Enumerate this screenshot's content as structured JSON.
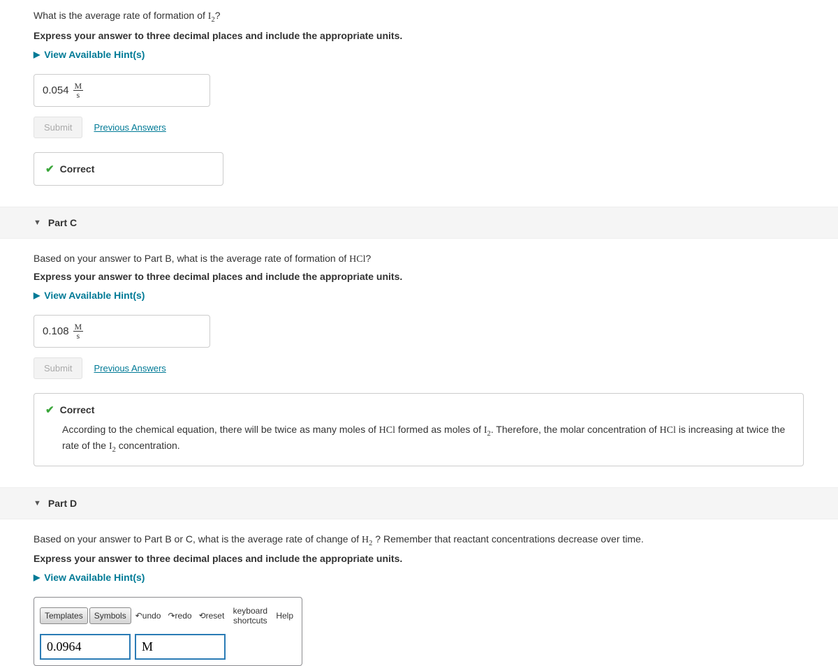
{
  "partB": {
    "question": "What is the average rate of formation of ",
    "question_formula": "I",
    "question_sub": "2",
    "question_tail": "?",
    "instruction": "Express your answer to three decimal places and include the appropriate units.",
    "hints_label": "View Available Hint(s)",
    "answer_value": "0.054",
    "answer_unit_num": "M",
    "answer_unit_den": "s",
    "submit_label": "Submit",
    "prev_label": "Previous Answers",
    "feedback_label": "Correct"
  },
  "partC": {
    "header": "Part C",
    "question_pre": "Based on your answer to Part B, what is the average rate of formation of ",
    "question_formula": "HCl",
    "question_tail": "?",
    "instruction": "Express your answer to three decimal places and include the appropriate units.",
    "hints_label": "View Available Hint(s)",
    "answer_value": "0.108",
    "answer_unit_num": "M",
    "answer_unit_den": "s",
    "submit_label": "Submit",
    "prev_label": "Previous Answers",
    "feedback_label": "Correct",
    "explain_1": "According to the chemical equation, there will be twice as many moles of ",
    "explain_hcl": "HCl",
    "explain_2": " formed as moles of ",
    "explain_i2": "I",
    "explain_i2_sub": "2",
    "explain_3": ". Therefore, the molar concentration of ",
    "explain_4": " is increasing at twice the rate of the ",
    "explain_5": " concentration."
  },
  "partD": {
    "header": "Part D",
    "question_pre": "Based on your answer to Part B or C, what is the average rate of change of ",
    "question_formula": "H",
    "question_sub": "2",
    "question_tail": " ? Remember that reactant concentrations decrease over time.",
    "instruction": "Express your answer to three decimal places and include the appropriate units.",
    "hints_label": "View Available Hint(s)",
    "toolbar": {
      "templates": "Templates",
      "symbols": "Symbols",
      "undo": "undo",
      "redo": "redo",
      "reset": "reset",
      "keyboard": "keyboard shortcuts",
      "help": "Help"
    },
    "input_value": "0.0964",
    "input_units": "M"
  }
}
